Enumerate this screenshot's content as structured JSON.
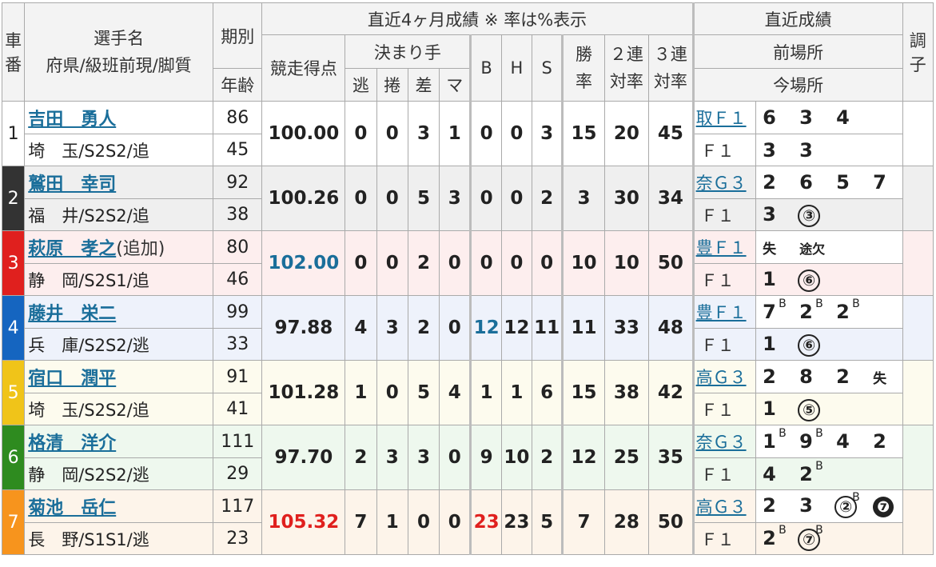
{
  "header": {
    "car_no": [
      "車",
      "番"
    ],
    "player": [
      "選手名",
      "府県/級班前現/脚質"
    ],
    "term": "期別",
    "age": "年齢",
    "recent4": "直近4ヶ月成績 ※ 率は%表示",
    "score": "競走得点",
    "kimarite": "決まり手",
    "k_labels": [
      "逃",
      "捲",
      "差",
      "マ"
    ],
    "bhs": [
      "B",
      "H",
      "S"
    ],
    "win_rate": [
      "勝",
      "率"
    ],
    "rate2": [
      "２連",
      "対率"
    ],
    "rate3": [
      "３連",
      "対率"
    ],
    "recent_results": "直近成績",
    "prev_venue": "前場所",
    "this_venue": "今場所",
    "condition": [
      "調",
      "子"
    ]
  },
  "colors": {
    "car1": "#ffffff",
    "car2": "#333333",
    "car3": "#e0201e",
    "car4": "#1565c0",
    "car5": "#f0c419",
    "car6": "#2e8b1f",
    "car7": "#f7941d",
    "row1": "#ffffff",
    "row2": "#efefef",
    "row3": "#fdeeee",
    "row4": "#eef2fb",
    "row5": "#fdfbee",
    "row6": "#eef8ee",
    "row7": "#fdf4ea"
  },
  "riders": [
    {
      "car": "1",
      "name": "吉田　勇人",
      "extra": "",
      "info": "埼　玉/S2S2/追",
      "term": "86",
      "age": "45",
      "score": "100.00",
      "score_color": "",
      "k": [
        "0",
        "0",
        "3",
        "1"
      ],
      "b": "0",
      "b_color": "",
      "h": "0",
      "s": "3",
      "win": "15",
      "r2": "20",
      "r3": "45",
      "prev_venue": "取Ｆ１",
      "prev": [
        "6",
        "3",
        "4"
      ],
      "this_venue": "Ｆ１",
      "now": [
        "3",
        "3"
      ]
    },
    {
      "car": "2",
      "name": "鷲田　幸司",
      "extra": "",
      "info": "福　井/S2S2/追",
      "term": "92",
      "age": "38",
      "score": "100.26",
      "score_color": "",
      "k": [
        "0",
        "0",
        "5",
        "3"
      ],
      "b": "0",
      "b_color": "",
      "h": "0",
      "s": "2",
      "win": "3",
      "r2": "30",
      "r3": "34",
      "prev_venue": "奈Ｇ３",
      "prev": [
        "2",
        "6",
        "5",
        "7"
      ],
      "this_venue": "Ｆ１",
      "now": [
        "3",
        "③"
      ]
    },
    {
      "car": "3",
      "name": "萩原　孝之",
      "extra": "(追加)",
      "info": "静　岡/S2S1/追",
      "term": "80",
      "age": "46",
      "score": "102.00",
      "score_color": "blue",
      "k": [
        "0",
        "0",
        "2",
        "0"
      ],
      "b": "0",
      "b_color": "",
      "h": "0",
      "s": "0",
      "win": "10",
      "r2": "10",
      "r3": "50",
      "prev_venue": "豊Ｆ１",
      "prev": [
        "失",
        "途欠"
      ],
      "this_venue": "Ｆ１",
      "now": [
        "1",
        "⑥"
      ]
    },
    {
      "car": "4",
      "name": "藤井　栄二",
      "extra": "",
      "info": "兵　庫/S2S2/逃",
      "term": "99",
      "age": "33",
      "score": "97.88",
      "score_color": "",
      "k": [
        "4",
        "3",
        "2",
        "0"
      ],
      "b": "12",
      "b_color": "blue",
      "h": "12",
      "s": "11",
      "win": "11",
      "r2": "33",
      "r3": "48",
      "prev_venue": "豊Ｆ１",
      "prev": [
        "7B",
        "2B",
        "2B"
      ],
      "this_venue": "Ｆ１",
      "now": [
        "1",
        "⑥"
      ]
    },
    {
      "car": "5",
      "name": "宿口　潤平",
      "extra": "",
      "info": "埼　玉/S2S2/追",
      "term": "91",
      "age": "41",
      "score": "101.28",
      "score_color": "",
      "k": [
        "1",
        "0",
        "5",
        "4"
      ],
      "b": "1",
      "b_color": "",
      "h": "1",
      "s": "6",
      "win": "15",
      "r2": "38",
      "r3": "42",
      "prev_venue": "高Ｇ３",
      "prev": [
        "2",
        "8",
        "2",
        "失"
      ],
      "this_venue": "Ｆ１",
      "now": [
        "1",
        "⑤"
      ]
    },
    {
      "car": "6",
      "name": "格清　洋介",
      "extra": "",
      "info": "静　岡/S2S2/逃",
      "term": "111",
      "age": "29",
      "score": "97.70",
      "score_color": "",
      "k": [
        "2",
        "3",
        "3",
        "0"
      ],
      "b": "9",
      "b_color": "",
      "h": "10",
      "s": "2",
      "win": "12",
      "r2": "25",
      "r3": "35",
      "prev_venue": "奈Ｇ３",
      "prev": [
        "1B",
        "9B",
        "4",
        "2"
      ],
      "this_venue": "Ｆ１",
      "now": [
        "4",
        "2B"
      ]
    },
    {
      "car": "7",
      "name": "菊池　岳仁",
      "extra": "",
      "info": "長　野/S1S1/逃",
      "term": "117",
      "age": "23",
      "score": "105.32",
      "score_color": "red",
      "k": [
        "7",
        "1",
        "0",
        "0"
      ],
      "b": "23",
      "b_color": "red",
      "h": "23",
      "s": "5",
      "win": "7",
      "r2": "28",
      "r3": "50",
      "prev_venue": "高Ｇ３",
      "prev": [
        "2",
        "3",
        "②B",
        "❼"
      ],
      "this_venue": "Ｆ１",
      "now": [
        "2B",
        "⑦B"
      ]
    }
  ]
}
